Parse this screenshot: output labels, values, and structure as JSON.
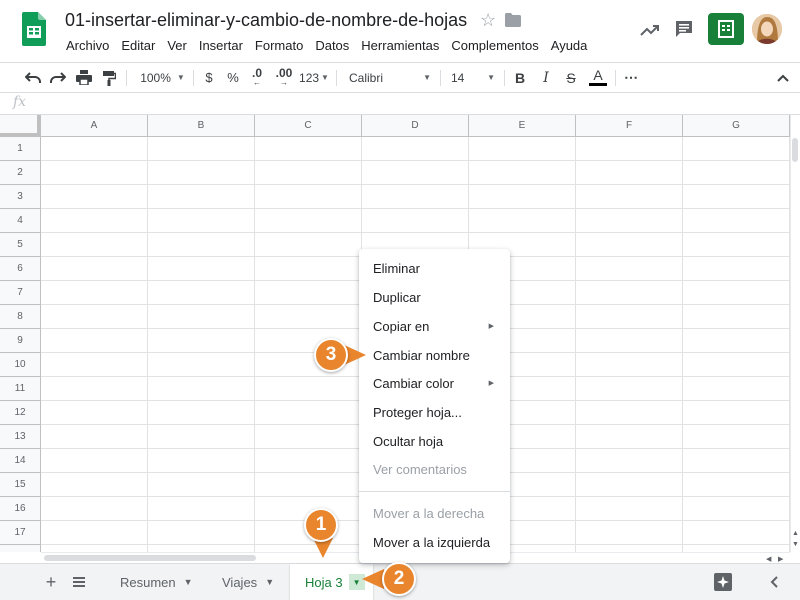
{
  "header": {
    "doc_title": "01-insertar-eliminar-y-cambio-de-nombre-de-hojas",
    "menu": [
      "Archivo",
      "Editar",
      "Ver",
      "Insertar",
      "Formato",
      "Datos",
      "Herramientas",
      "Complementos",
      "Ayuda"
    ]
  },
  "toolbar": {
    "zoom": "100%",
    "currency": "$",
    "percent": "%",
    "decimal_decrease": ".0",
    "decimal_increase": ".00",
    "number_format": "123",
    "font": "Calibri",
    "font_size": "14",
    "bold": "B",
    "italic": "I",
    "strike": "S",
    "text_color": "A",
    "more": "⋯"
  },
  "formula_bar": {
    "fx": "fx"
  },
  "grid": {
    "columns": [
      "A",
      "B",
      "C",
      "D",
      "E",
      "F",
      "G"
    ],
    "rows": [
      "1",
      "2",
      "3",
      "4",
      "5",
      "6",
      "7",
      "8",
      "9",
      "10",
      "11",
      "12",
      "13",
      "14",
      "15",
      "16",
      "17"
    ]
  },
  "sheets": {
    "tabs": [
      {
        "label": "Resumen",
        "active": false
      },
      {
        "label": "Viajes",
        "active": false
      },
      {
        "label": "Hoja 3",
        "active": true
      }
    ]
  },
  "context_menu": {
    "items": [
      {
        "label": "Eliminar",
        "enabled": true,
        "submenu": false
      },
      {
        "label": "Duplicar",
        "enabled": true,
        "submenu": false
      },
      {
        "label": "Copiar en",
        "enabled": true,
        "submenu": true
      },
      {
        "label": "Cambiar nombre",
        "enabled": true,
        "submenu": false
      },
      {
        "label": "Cambiar color",
        "enabled": true,
        "submenu": true
      },
      {
        "label": "Proteger hoja...",
        "enabled": true,
        "submenu": false
      },
      {
        "label": "Ocultar hoja",
        "enabled": true,
        "submenu": false
      },
      {
        "label": "Ver comentarios",
        "enabled": false,
        "submenu": false
      },
      {
        "label": "Mover a la derecha",
        "enabled": false,
        "submenu": false
      },
      {
        "label": "Mover a la izquierda",
        "enabled": true,
        "submenu": false
      }
    ]
  },
  "callouts": [
    "1",
    "2",
    "3"
  ],
  "colors": {
    "accent": "#188038",
    "callout": "#e9852d"
  }
}
